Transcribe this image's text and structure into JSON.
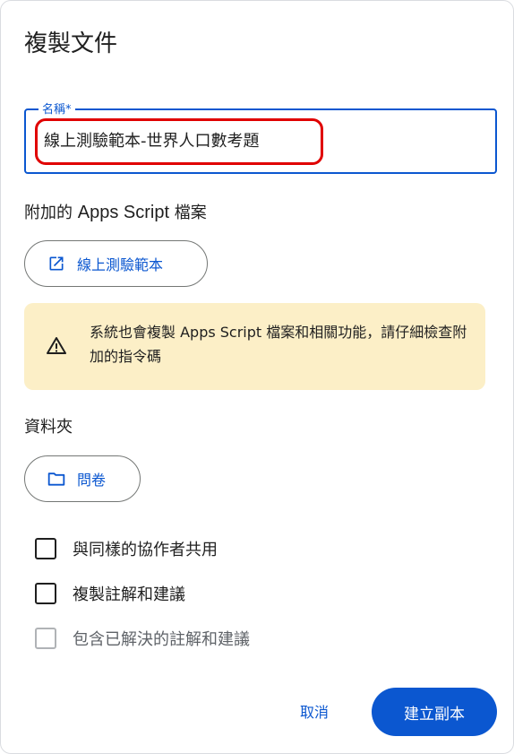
{
  "dialog": {
    "title": "複製文件",
    "name_field": {
      "label": "名稱*",
      "value": "線上測驗範本-世界人口數考題"
    },
    "script_section": {
      "label_prefix": "附加的 ",
      "label_bold": "Apps Script",
      "label_suffix": " 檔案",
      "chip_label": "線上測驗範本"
    },
    "warning": {
      "text": "系統也會複製 Apps Script 檔案和相關功能，請仔細檢查附加的指令碼"
    },
    "folder_section": {
      "label": "資料夾",
      "chip_label": "問卷"
    },
    "options": [
      {
        "label": "與同樣的協作者共用",
        "checked": false,
        "enabled": true
      },
      {
        "label": "複製註解和建議",
        "checked": false,
        "enabled": true
      },
      {
        "label": "包含已解決的註解和建議",
        "checked": false,
        "enabled": false
      }
    ],
    "buttons": {
      "cancel": "取消",
      "create": "建立副本"
    },
    "colors": {
      "accent": "#0b57d0",
      "warning_bg": "#fcefc7",
      "highlight": "#e00000"
    }
  }
}
